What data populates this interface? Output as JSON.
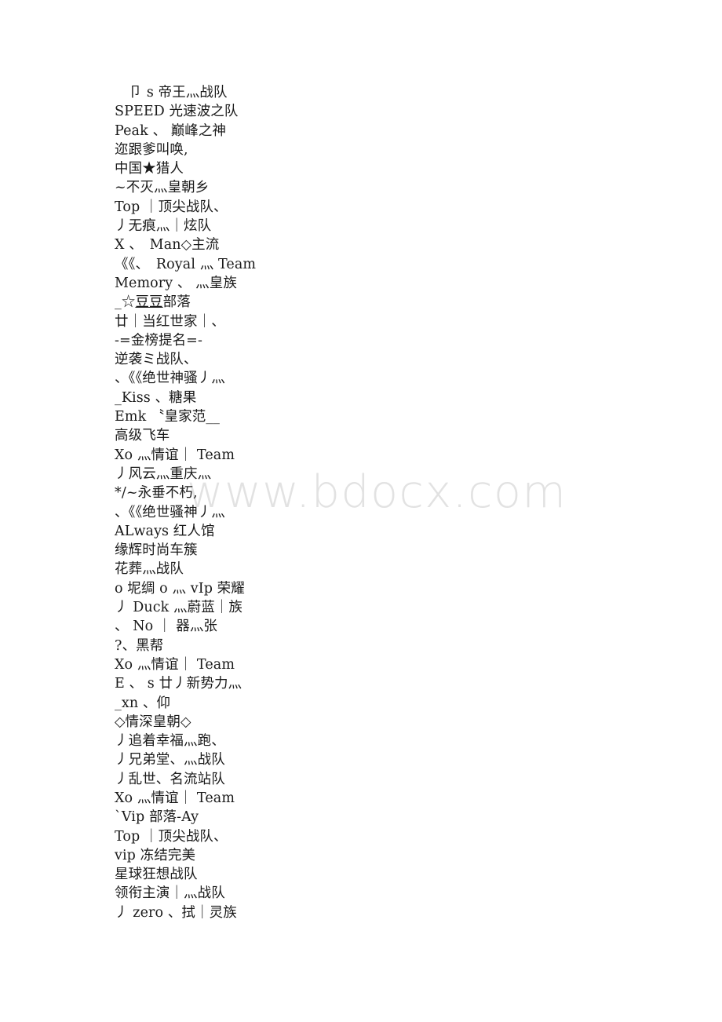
{
  "document": {
    "watermark": "www.bdocx.com",
    "watermark_color": "#e2e2e2",
    "page_background": "#ffffff",
    "text_color": "#1a1a1a",
    "lines": [
      "　卩 s 帝王灬战队",
      "SPEED 光速波之队",
      "Peak 、 巅峰之神",
      "迩跟爹叫唤,",
      "中国★猎人",
      "~不灭灬皇朝乡",
      "Top ｜顶尖战队、",
      "丿无痕灬｜炫队",
      "X 、　Man◇主流",
      "《《、　Royal 灬 Team",
      "Memory 、 灬皇族",
      "_☆豆豆部落",
      "廿｜当红世家｜、",
      "-=金榜提名=-",
      "逆袭ミ战队、",
      "、《《绝世神骚丿灬",
      "_Kiss 、糖果",
      "Emk 〝皇家范__",
      "高级飞车",
      "Xo 灬情谊｜ Team",
      "丿风云灬重庆灬",
      "*/~永垂不朽,",
      "、《《绝世骚神丿灬",
      "ALways 红人馆",
      "缘辉时尚车簇",
      "花葬灬战队",
      "o 坭绸 o 灬 vIp 荣耀",
      "丿 Duck 灬蔚蓝｜族",
      "、 No ｜ 器灬张",
      "?、黑帮",
      "Xo 灬情谊｜ Team",
      "E 、 s 廿丿新势力灬",
      "_xn 、仰",
      "◇情深皇朝◇",
      "丿追着幸福灬跑、",
      "丿兄弟堂、灬战队",
      "丿乱世、名流站队",
      "Xo 灬情谊｜ Team",
      "ˋVip 部落-Ay",
      "Top ｜顶尖战队、",
      "vip 冻结完美",
      "星球狂想战队",
      "领衔主演｜灬战队",
      "丿 zero 、拭｜灵族"
    ],
    "underlined_line_index": 11,
    "underlined_segment": "豆豆"
  }
}
